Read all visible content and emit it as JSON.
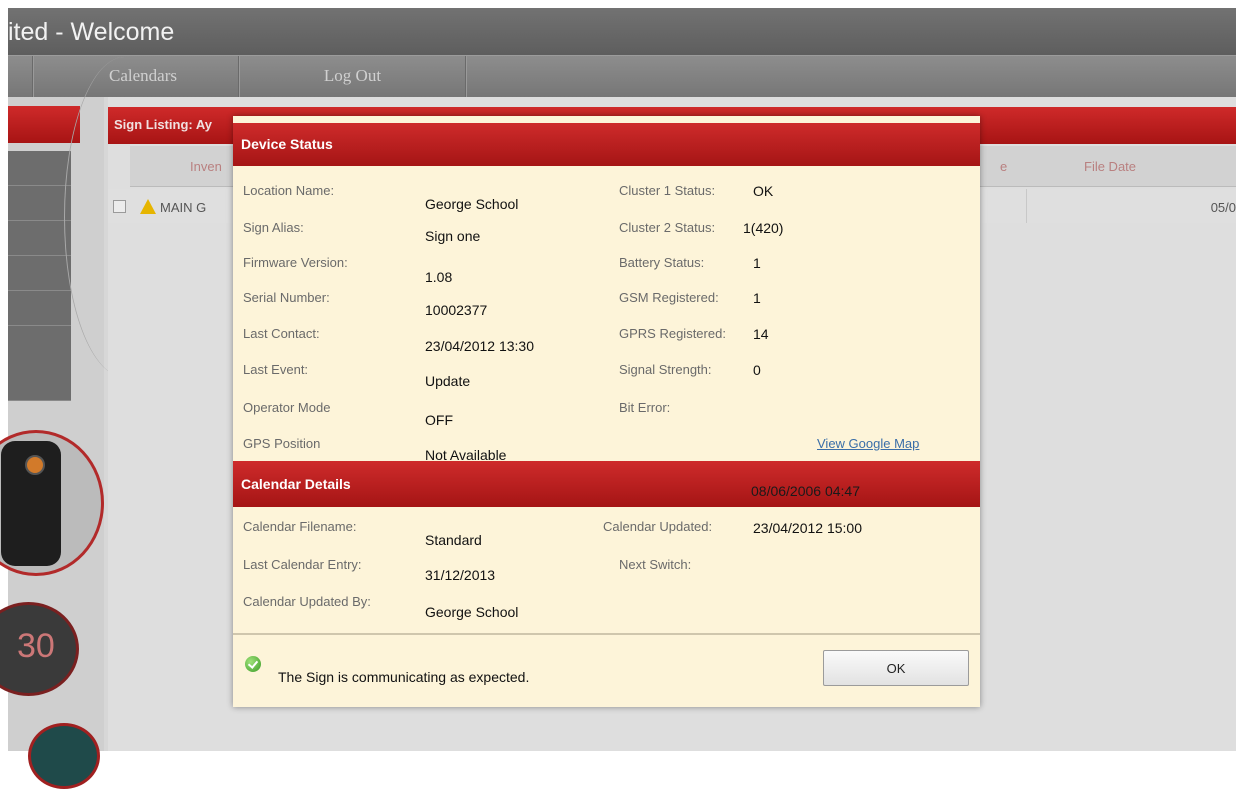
{
  "window": {
    "title": "ited - Welcome"
  },
  "nav": {
    "items": [
      "Calendars",
      "Log Out"
    ]
  },
  "listing": {
    "header": "Sign Listing: Ay",
    "columns": {
      "inventory": "Inven",
      "e": "e",
      "file_date": "File Date"
    },
    "row": {
      "label": "MAIN G",
      "date": "05/0"
    }
  },
  "gauge_text": "30",
  "modal": {
    "title": "Device Status",
    "status": {
      "location_name": {
        "label": "Location Name:",
        "value": "George School"
      },
      "sign_alias": {
        "label": "Sign Alias:",
        "value": "Sign one"
      },
      "firmware_version": {
        "label": "Firmware Version:",
        "value": "1.08"
      },
      "serial_number": {
        "label": "Serial Number:",
        "value": "10002377"
      },
      "last_contact": {
        "label": "Last Contact:",
        "value": "23/04/2012 13:30"
      },
      "last_event": {
        "label": "Last Event:",
        "value": "Update"
      },
      "operator_mode": {
        "label": "Operator Mode",
        "value": "OFF"
      },
      "gps_position": {
        "label": "GPS Position",
        "value": "Not Available"
      },
      "cluster1": {
        "label": "Cluster 1 Status:",
        "value": "OK"
      },
      "cluster2": {
        "label": "Cluster 2 Status:",
        "value": "1(420)"
      },
      "battery": {
        "label": "Battery Status:",
        "value": "1"
      },
      "gsm": {
        "label": "GSM Registered:",
        "value": "1"
      },
      "gprs": {
        "label": "GPRS Registered:",
        "value": "14"
      },
      "signal": {
        "label": "Signal Strength:",
        "value": "0"
      },
      "bit_error": {
        "label": "Bit Error:",
        "value": ""
      },
      "map_link": "View Google Map"
    },
    "calendar": {
      "title": "Calendar Details",
      "header_date": "08/06/2006 04:47",
      "filename": {
        "label": "Calendar Filename:",
        "value": "Standard"
      },
      "last_entry": {
        "label": "Last Calendar Entry:",
        "value": "31/12/2013"
      },
      "updated_by": {
        "label": "Calendar Updated By:",
        "value": "George School"
      },
      "updated": {
        "label": "Calendar Updated:",
        "value": "23/04/2012 15:00"
      },
      "next_switch": {
        "label": "Next Switch:",
        "value": ""
      }
    },
    "message": "The Sign is communicating as expected.",
    "ok_label": "OK"
  }
}
